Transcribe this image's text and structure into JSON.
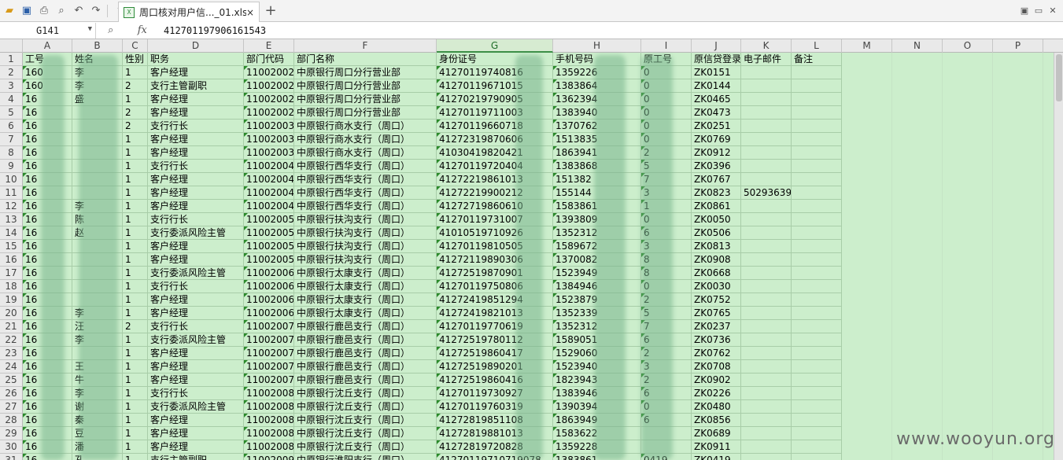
{
  "titlebar": {
    "doc_tab": "周口核对用户信..._01.xls",
    "close": "×",
    "new_tab": "+"
  },
  "formulabar": {
    "cell_ref": "G141",
    "fx": "fx",
    "value": "412701197906161543"
  },
  "columns": [
    "A",
    "B",
    "C",
    "D",
    "E",
    "F",
    "G",
    "H",
    "I",
    "J",
    "K",
    "L",
    "M",
    "N",
    "O",
    "P"
  ],
  "selected_column": "G",
  "rows": [
    [
      "工号",
      "姓名",
      "性别",
      "职务",
      "部门代码",
      "部门名称",
      "身份证号",
      "手机号码",
      "原工号",
      "原信贷登录",
      "电子邮件",
      "备注"
    ],
    [
      "160",
      "李",
      "1",
      "客户经理",
      "11002002",
      "中原银行周口分行营业部",
      "41270119740816",
      "1359226",
      "0",
      "ZK0151",
      "",
      ""
    ],
    [
      "160",
      "李",
      "2",
      "支行主管副职",
      "11002002",
      "中原银行周口分行营业部",
      "41270119671015",
      "1383864",
      "0",
      "ZK0144",
      "",
      ""
    ],
    [
      "16",
      "盛",
      "1",
      "客户经理",
      "11002002",
      "中原银行周口分行营业部",
      "41270219790905",
      "1362394",
      "0",
      "ZK0465",
      "",
      ""
    ],
    [
      "16",
      "",
      "2",
      "客户经理",
      "11002002",
      "中原银行周口分行营业部",
      "41270119711003",
      "1383940",
      "0",
      "ZK0473",
      "",
      ""
    ],
    [
      "16",
      "",
      "2",
      "支行行长",
      "11002003",
      "中原银行商水支行（周口）",
      "41270119660718",
      "1370762",
      "0",
      "ZK0251",
      "",
      ""
    ],
    [
      "16",
      "",
      "1",
      "客户经理",
      "11002003",
      "中原银行商水支行（周口）",
      "41272319870606",
      "1513835",
      "0",
      "ZK0769",
      "",
      ""
    ],
    [
      "16",
      "",
      "1",
      "客户经理",
      "11002003",
      "中原银行商水支行（周口）",
      "41030419820421",
      "1863941",
      "2",
      "ZK0912",
      "",
      ""
    ],
    [
      "16",
      "",
      "1",
      "支行行长",
      "11002004",
      "中原银行西华支行（周口）",
      "41270119720404",
      "1383868",
      "5",
      "ZK0396",
      "",
      ""
    ],
    [
      "16",
      "",
      "1",
      "客户经理",
      "11002004",
      "中原银行西华支行（周口）",
      "41272219861013",
      "151382",
      "7",
      "ZK0767",
      "",
      ""
    ],
    [
      "16",
      "",
      "1",
      "客户经理",
      "11002004",
      "中原银行西华支行（周口）",
      "41272219900212",
      "155144",
      "3",
      "ZK0823",
      "502936397",
      ""
    ],
    [
      "16",
      "李",
      "1",
      "客户经理",
      "11002004",
      "中原银行西华支行（周口）",
      "41272719860610",
      "1583861",
      "1",
      "ZK0861",
      "",
      ""
    ],
    [
      "16",
      "陈",
      "1",
      "支行行长",
      "11002005",
      "中原银行扶沟支行（周口）",
      "41270119731007",
      "1393809",
      "0",
      "ZK0050",
      "",
      ""
    ],
    [
      "16",
      "赵",
      "1",
      "支行委派风险主管",
      "11002005",
      "中原银行扶沟支行（周口）",
      "41010519710926",
      "1352312",
      "6",
      "ZK0506",
      "",
      ""
    ],
    [
      "16",
      "",
      "1",
      "客户经理",
      "11002005",
      "中原银行扶沟支行（周口）",
      "41270119810505",
      "1589672",
      "3",
      "ZK0813",
      "",
      ""
    ],
    [
      "16",
      "",
      "1",
      "客户经理",
      "11002005",
      "中原银行扶沟支行（周口）",
      "41272119890306",
      "1370082",
      "8",
      "ZK0908",
      "",
      ""
    ],
    [
      "16",
      "",
      "1",
      "支行委派风险主管",
      "11002006",
      "中原银行太康支行（周口）",
      "41272519870901",
      "1523949",
      "8",
      "ZK0668",
      "",
      ""
    ],
    [
      "16",
      "",
      "1",
      "支行行长",
      "11002006",
      "中原银行太康支行（周口）",
      "41270119750806",
      "1384946",
      "0",
      "ZK0030",
      "",
      ""
    ],
    [
      "16",
      "",
      "1",
      "客户经理",
      "11002006",
      "中原银行太康支行（周口）",
      "41272419851294",
      "1523879",
      "2",
      "ZK0752",
      "",
      ""
    ],
    [
      "16",
      "李",
      "1",
      "客户经理",
      "11002006",
      "中原银行太康支行（周口）",
      "41272419821013",
      "1352339",
      "5",
      "ZK0765",
      "",
      ""
    ],
    [
      "16",
      "汪",
      "2",
      "支行行长",
      "11002007",
      "中原银行鹿邑支行（周口）",
      "41270119770619",
      "1352312",
      "7",
      "ZK0237",
      "",
      ""
    ],
    [
      "16",
      "李",
      "1",
      "支行委派风险主管",
      "11002007",
      "中原银行鹿邑支行（周口）",
      "41272519780112",
      "1589051",
      "6",
      "ZK0736",
      "",
      ""
    ],
    [
      "16",
      "",
      "1",
      "客户经理",
      "11002007",
      "中原银行鹿邑支行（周口）",
      "41272519860417",
      "1529060",
      "2",
      "ZK0762",
      "",
      ""
    ],
    [
      "16",
      "王",
      "1",
      "客户经理",
      "11002007",
      "中原银行鹿邑支行（周口）",
      "41272519890201",
      "1523940",
      "3",
      "ZK0708",
      "",
      ""
    ],
    [
      "16",
      "牛",
      "1",
      "客户经理",
      "11002007",
      "中原银行鹿邑支行（周口）",
      "41272519860416",
      "1823943",
      "2",
      "ZK0902",
      "",
      ""
    ],
    [
      "16",
      "李",
      "1",
      "支行行长",
      "11002008",
      "中原银行沈丘支行（周口）",
      "41270119730927",
      "1383946",
      "6",
      "ZK0226",
      "",
      ""
    ],
    [
      "16",
      "谢",
      "1",
      "支行委派风险主管",
      "11002008",
      "中原银行沈丘支行（周口）",
      "41270119760319",
      "1390394",
      "0",
      "ZK0480",
      "",
      ""
    ],
    [
      "16",
      "秦",
      "1",
      "客户经理",
      "11002008",
      "中原银行沈丘支行（周口）",
      "41272819851108",
      "1863949",
      "6",
      "ZK0856",
      "",
      ""
    ],
    [
      "16",
      "豆",
      "1",
      "客户经理",
      "11002008",
      "中原银行沈丘支行（周口）",
      "41272819881013",
      "1583622",
      "",
      "ZK0689",
      "",
      ""
    ],
    [
      "16",
      "潘",
      "1",
      "客户经理",
      "11002008",
      "中原银行沈丘支行（周口）",
      "41272819720828",
      "1359228",
      "",
      "ZK0911",
      "",
      ""
    ],
    [
      "16",
      "孔",
      "1",
      "支行主管副职",
      "11002009",
      "中原银行淮阳支行（周口）",
      "41270119710719078",
      "1383861",
      "0419",
      "ZK0419",
      "",
      ""
    ]
  ],
  "watermark": "www.wooyun.org"
}
